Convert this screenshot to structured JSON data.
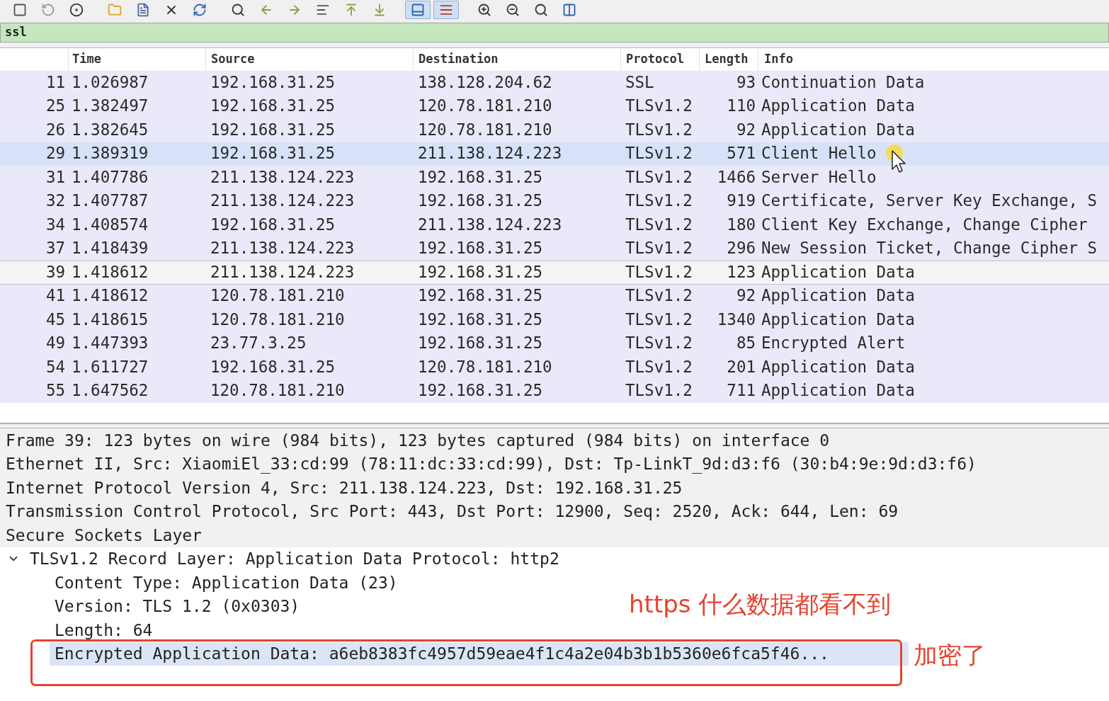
{
  "toolbar": {
    "buttons": [
      {
        "selected": false
      },
      {
        "selected": false
      },
      {
        "selected": false
      },
      {
        "selected": false
      },
      {
        "selected": false
      },
      {
        "selected": false
      },
      {
        "selected": false
      },
      {
        "selected": false
      },
      {
        "selected": false
      },
      {
        "selected": false
      },
      {
        "selected": false
      },
      {
        "selected": false
      },
      {
        "selected": false
      },
      {
        "selected": true
      },
      {
        "selected": true
      },
      {
        "selected": false
      },
      {
        "selected": false
      },
      {
        "selected": false
      },
      {
        "selected": false
      }
    ]
  },
  "filter": {
    "value": "ssl"
  },
  "packet_list": {
    "columns": [
      "",
      "Time",
      "Source",
      "Destination",
      "Protocol",
      "Length",
      "Info"
    ],
    "rows": [
      {
        "cells": [
          "11",
          "1.026987",
          "192.168.31.25",
          "138.128.204.62",
          "SSL",
          "93",
          "Continuation Data"
        ],
        "selected": false,
        "hovered": false
      },
      {
        "cells": [
          "25",
          "1.382497",
          "192.168.31.25",
          "120.78.181.210",
          "TLSv1.2",
          "110",
          "Application Data"
        ],
        "selected": false,
        "hovered": false
      },
      {
        "cells": [
          "26",
          "1.382645",
          "192.168.31.25",
          "120.78.181.210",
          "TLSv1.2",
          "92",
          "Application Data"
        ],
        "selected": false,
        "hovered": false
      },
      {
        "cells": [
          "29",
          "1.389319",
          "192.168.31.25",
          "211.138.124.223",
          "TLSv1.2",
          "571",
          "Client Hello"
        ],
        "selected": false,
        "hovered": true
      },
      {
        "cells": [
          "31",
          "1.407786",
          "211.138.124.223",
          "192.168.31.25",
          "TLSv1.2",
          "1466",
          "Server Hello"
        ],
        "selected": false,
        "hovered": false
      },
      {
        "cells": [
          "32",
          "1.407787",
          "211.138.124.223",
          "192.168.31.25",
          "TLSv1.2",
          "919",
          "Certificate, Server Key Exchange, S"
        ],
        "selected": false,
        "hovered": false
      },
      {
        "cells": [
          "34",
          "1.408574",
          "192.168.31.25",
          "211.138.124.223",
          "TLSv1.2",
          "180",
          "Client Key Exchange, Change Cipher"
        ],
        "selected": false,
        "hovered": false
      },
      {
        "cells": [
          "37",
          "1.418439",
          "211.138.124.223",
          "192.168.31.25",
          "TLSv1.2",
          "296",
          "New Session Ticket, Change Cipher S"
        ],
        "selected": false,
        "hovered": false
      },
      {
        "cells": [
          "39",
          "1.418612",
          "211.138.124.223",
          "192.168.31.25",
          "TLSv1.2",
          "123",
          "Application Data"
        ],
        "selected": true,
        "hovered": false
      },
      {
        "cells": [
          "41",
          "1.418612",
          "120.78.181.210",
          "192.168.31.25",
          "TLSv1.2",
          "92",
          "Application Data"
        ],
        "selected": false,
        "hovered": false
      },
      {
        "cells": [
          "45",
          "1.418615",
          "120.78.181.210",
          "192.168.31.25",
          "TLSv1.2",
          "1340",
          "Application Data"
        ],
        "selected": false,
        "hovered": false
      },
      {
        "cells": [
          "49",
          "1.447393",
          "23.77.3.25",
          "192.168.31.25",
          "TLSv1.2",
          "85",
          "Encrypted Alert"
        ],
        "selected": false,
        "hovered": false
      },
      {
        "cells": [
          "54",
          "1.611727",
          "192.168.31.25",
          "120.78.181.210",
          "TLSv1.2",
          "201",
          "Application Data"
        ],
        "selected": false,
        "hovered": false
      },
      {
        "cells": [
          "55",
          "1.647562",
          "120.78.181.210",
          "192.168.31.25",
          "TLSv1.2",
          "711",
          "Application Data"
        ],
        "selected": false,
        "hovered": false
      }
    ]
  },
  "details": {
    "lines": [
      {
        "text": "Frame 39: 123 bytes on wire (984 bits), 123 bytes captured (984 bits) on interface 0"
      },
      {
        "text": "Ethernet II, Src: XiaomiEl_33:cd:99 (78:11:dc:33:cd:99), Dst: Tp-LinkT_9d:d3:f6 (30:b4:9e:9d:d3:f6)"
      },
      {
        "text": "Internet Protocol Version 4, Src: 211.138.124.223, Dst: 192.168.31.25"
      },
      {
        "text": "Transmission Control Protocol, Src Port: 443, Dst Port: 12900, Seq: 2520, Ack: 644, Len: 69"
      },
      {
        "text": "Secure Sockets Layer"
      }
    ],
    "tree": {
      "label": "TLSv1.2 Record Layer: Application Data Protocol: http2",
      "expanded": true,
      "children": [
        {
          "text": "Content Type: Application Data (23)",
          "selected": false
        },
        {
          "text": "Version: TLS 1.2 (0x0303)",
          "selected": false
        },
        {
          "text": "Length: 64",
          "selected": false
        },
        {
          "text": "Encrypted Application Data: a6eb8383fc4957d59eae4f1c4a2e04b3b1b5360e6fca5f46...",
          "selected": true
        }
      ]
    }
  },
  "annotation": {
    "note": "https 什么数据都看不到",
    "box_label": "加密了"
  }
}
